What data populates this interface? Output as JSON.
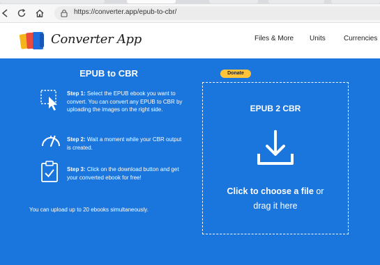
{
  "browser": {
    "url": "https://converter.app/epub-to-cbr/",
    "back_icon": "back-icon",
    "refresh_icon": "refresh-icon",
    "home_icon": "home-icon",
    "site_info_icon": "site-info-icon"
  },
  "header": {
    "brand": "Converter App",
    "nav": [
      "Files & More",
      "Units",
      "Currencies"
    ]
  },
  "left": {
    "title": "EPUB to CBR",
    "steps": [
      {
        "label": "Step 1:",
        "text": "Select the EPUB ebook you want to convert. You can convert any EPUB to CBR by uploading the images on the right side.",
        "icon": "cursor-select-icon"
      },
      {
        "label": "Step 2:",
        "text": "Wait a moment while your CBR output is created.",
        "icon": "speedometer-icon"
      },
      {
        "label": "Step 3:",
        "text": "Click on the download button and get your converted ebook for free!",
        "icon": "clipboard-check-icon"
      }
    ],
    "upload_note": "You can upload up to 20 ebooks simultaneously."
  },
  "donate_label": "Donate",
  "dropzone": {
    "title": "EPUB 2 CBR",
    "cta_strong": "Click to choose a file",
    "cta_rest": "or",
    "cta_line2": "drag it here",
    "icon": "download-icon"
  },
  "colors": {
    "brand_blue": "#1a75dd",
    "donate_yellow": "#ffc439"
  }
}
